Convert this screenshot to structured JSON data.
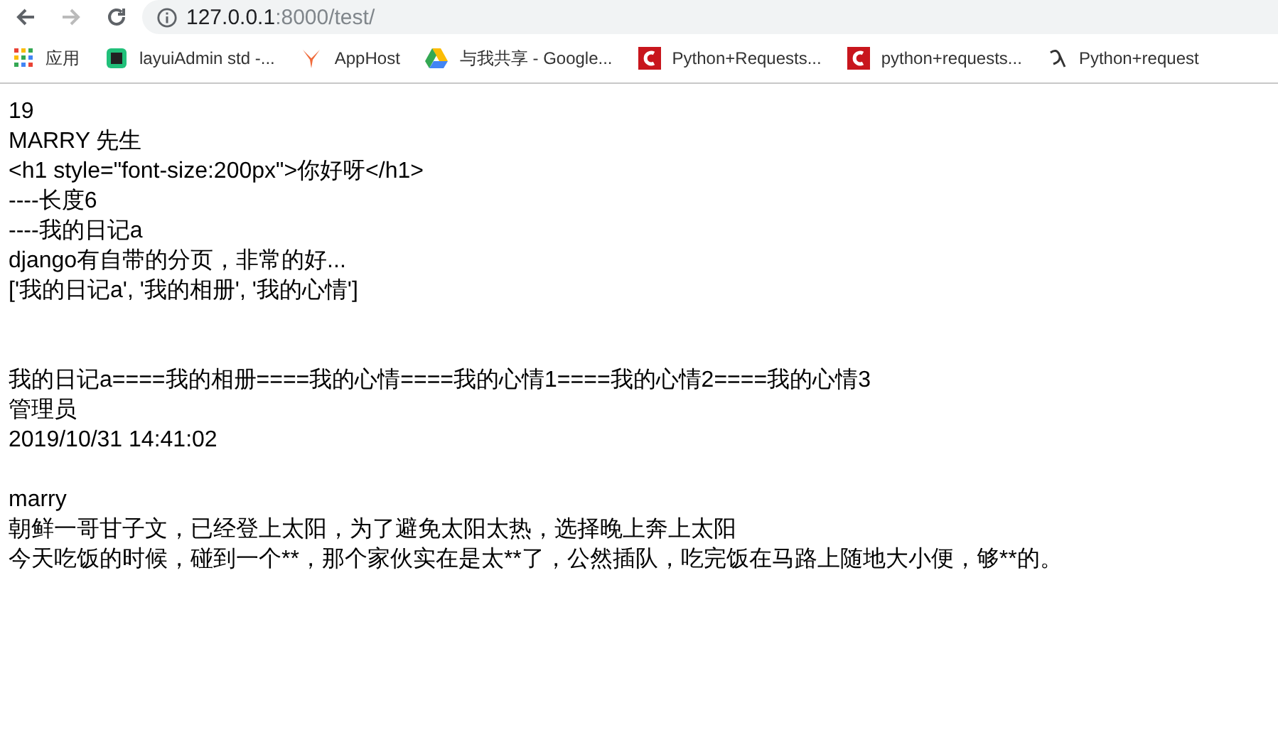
{
  "browser": {
    "url_host": "127.0.0.1",
    "url_path": ":8000/test/",
    "bookmarks": [
      {
        "kind": "apps",
        "label": "应用"
      },
      {
        "kind": "layui",
        "label": "layuiAdmin std -..."
      },
      {
        "kind": "apphost",
        "label": "AppHost"
      },
      {
        "kind": "drive",
        "label": "与我共享 - Google..."
      },
      {
        "kind": "csdn",
        "label": "Python+Requests..."
      },
      {
        "kind": "csdn",
        "label": "python+requests..."
      },
      {
        "kind": "script",
        "label": "Python+request"
      }
    ]
  },
  "page": {
    "lines": [
      {
        "kind": "text",
        "text": "19"
      },
      {
        "kind": "text",
        "text": "MARRY 先生"
      },
      {
        "kind": "text",
        "text": "<h1 style=\"font-size:200px\">你好呀</h1>"
      },
      {
        "kind": "text",
        "text": "----长度6"
      },
      {
        "kind": "text",
        "text": "----我的日记a"
      },
      {
        "kind": "text",
        "text": "django有自带的分页，非常的好..."
      },
      {
        "kind": "text",
        "text": "['我的日记a', '我的相册', '我的心情']"
      },
      {
        "kind": "blank"
      },
      {
        "kind": "blank"
      },
      {
        "kind": "text",
        "text": "我的日记a====我的相册====我的心情====我的心情1====我的心情2====我的心情3"
      },
      {
        "kind": "text",
        "text": "管理员"
      },
      {
        "kind": "text",
        "text": "2019/10/31 14:41:02"
      },
      {
        "kind": "blank"
      },
      {
        "kind": "text",
        "text": "marry"
      },
      {
        "kind": "text",
        "text": "朝鲜一哥甘子文，已经登上太阳，为了避免太阳太热，选择晚上奔上太阳"
      },
      {
        "kind": "text",
        "text": "今天吃饭的时候，碰到一个**，那个家伙实在是太**了，公然插队，吃完饭在马路上随地大小便，够**的。"
      }
    ]
  }
}
